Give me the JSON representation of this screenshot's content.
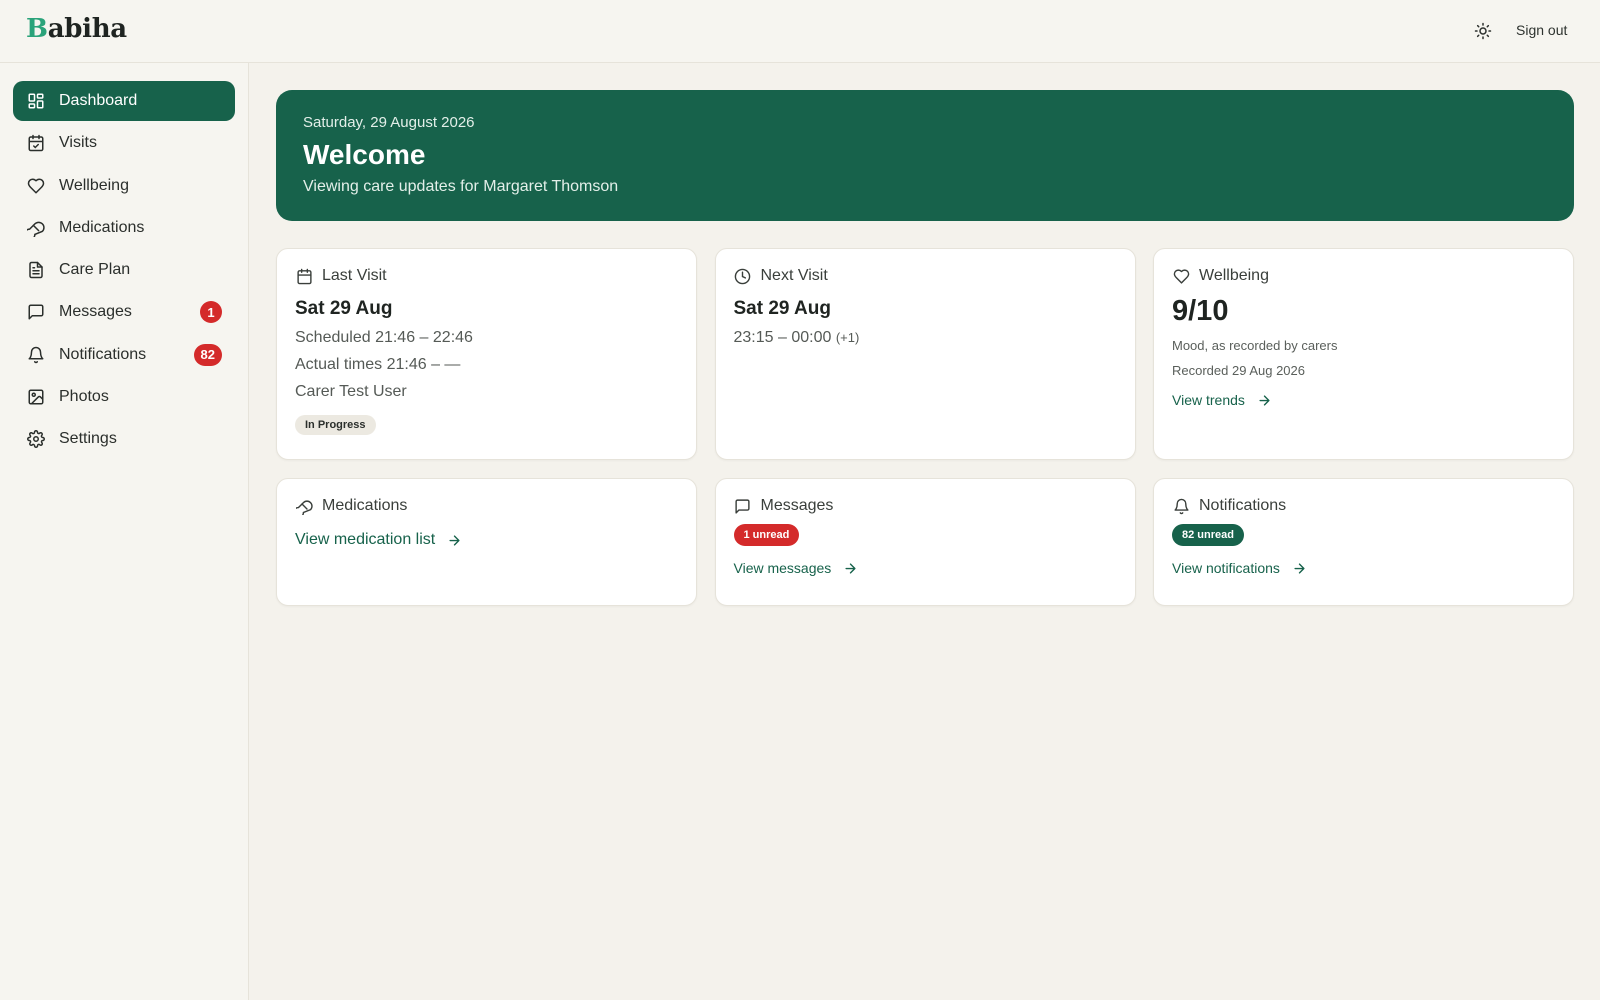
{
  "app": {
    "logo_initial": "B",
    "logo_rest": "abiha",
    "sign_out": "Sign out",
    "theme_icon": "sun-icon"
  },
  "colors": {
    "brand": "#17624b",
    "logo_accent": "#2aa37a",
    "badge_red": "#d42a2a",
    "background": "#f4f2ec"
  },
  "sidebar": {
    "items": [
      {
        "label": "Dashboard",
        "icon": "dashboard-icon",
        "active": true,
        "badge": ""
      },
      {
        "label": "Visits",
        "icon": "calendar-check-icon",
        "active": false,
        "badge": ""
      },
      {
        "label": "Wellbeing",
        "icon": "heart-icon",
        "active": false,
        "badge": ""
      },
      {
        "label": "Medications",
        "icon": "pill-icon",
        "active": false,
        "badge": ""
      },
      {
        "label": "Care Plan",
        "icon": "document-icon",
        "active": false,
        "badge": ""
      },
      {
        "label": "Messages",
        "icon": "message-icon",
        "active": false,
        "badge": "1"
      },
      {
        "label": "Notifications",
        "icon": "bell-icon",
        "active": false,
        "badge": "82"
      },
      {
        "label": "Photos",
        "icon": "image-icon",
        "active": false,
        "badge": ""
      },
      {
        "label": "Settings",
        "icon": "gear-icon",
        "active": false,
        "badge": ""
      }
    ]
  },
  "hero": {
    "date": "Saturday, 29 August 2026",
    "title": "Welcome",
    "subtitle": "Viewing care updates for Margaret Thomson"
  },
  "cards": {
    "last_visit": {
      "title": "Last Visit",
      "date": "Sat 29 Aug",
      "scheduled": "Scheduled 21:46 – 22:46",
      "actual": "Actual times 21:46 – —",
      "carer": "Carer Test User",
      "status": "In Progress"
    },
    "next_visit": {
      "title": "Next Visit",
      "date": "Sat 29 Aug",
      "time": "23:15 – 00:00",
      "day_offset": "(+1)"
    },
    "wellbeing": {
      "title": "Wellbeing",
      "score": "9/10",
      "description": "Mood, as recorded by carers",
      "recorded": "Recorded 29 Aug 2026",
      "link": "View trends"
    },
    "medications": {
      "title": "Medications",
      "link": "View medication list"
    },
    "messages": {
      "title": "Messages",
      "unread": "1 unread",
      "link": "View messages"
    },
    "notifications": {
      "title": "Notifications",
      "unread": "82 unread",
      "link": "View notifications"
    }
  }
}
